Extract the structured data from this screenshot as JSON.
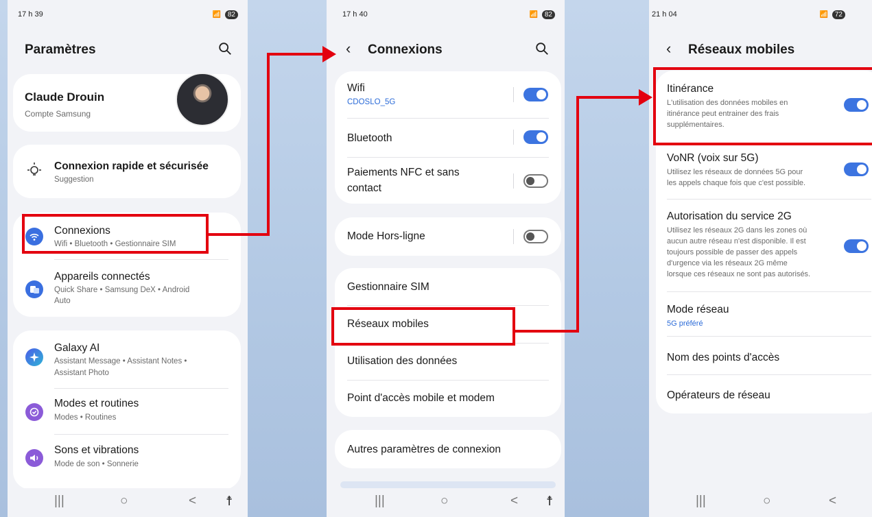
{
  "colors": {
    "accent": "#3c74e0",
    "highlight": "#e3000f",
    "background": "#c4d6ec"
  },
  "phone1": {
    "status": {
      "time": "17 h 39",
      "battery": "82"
    },
    "title": "Paramètres",
    "account": {
      "name": "Claude Drouin",
      "subtitle": "Compte Samsung"
    },
    "suggestion": {
      "title": "Connexion rapide et sécurisée",
      "subtitle": "Suggestion"
    },
    "items": [
      {
        "label": "Connexions",
        "sub": "Wifi • Bluetooth • Gestionnaire SIM",
        "icon": "wifi-icon"
      },
      {
        "label": "Appareils connectés",
        "sub1": "Quick Share • Samsung DeX • Android",
        "sub2": "Auto",
        "icon": "connected-devices-icon"
      },
      {
        "label": "Galaxy AI",
        "sub1": "Assistant Message • Assistant Notes •",
        "sub2": "Assistant Photo",
        "icon": "galaxy-ai-icon"
      },
      {
        "label": "Modes et routines",
        "sub": "Modes • Routines",
        "icon": "modes-icon"
      },
      {
        "label": "Sons et vibrations",
        "sub": "Mode de son • Sonnerie",
        "icon": "sound-icon"
      }
    ]
  },
  "phone2": {
    "status": {
      "time": "17 h 40",
      "battery": "82"
    },
    "title": "Connexions",
    "wifi": {
      "label": "Wifi",
      "sub": "CDOSLO_5G",
      "on": true
    },
    "bluetooth": {
      "label": "Bluetooth",
      "on": true
    },
    "nfc": {
      "label1": "Paiements NFC et sans",
      "label2": "contact",
      "on": false
    },
    "airplane": {
      "label": "Mode Hors-ligne",
      "on": false
    },
    "sim": "Gestionnaire SIM",
    "mobile": "Réseaux mobiles",
    "data": "Utilisation des données",
    "hotspot": "Point d'accès mobile et modem",
    "more": "Autres paramètres de connexion"
  },
  "phone3": {
    "status": {
      "time": "21 h 04",
      "battery": "72"
    },
    "title": "Réseaux mobiles",
    "roaming": {
      "label": "Itinérance",
      "sub": [
        "L'utilisation des données mobiles en",
        "itinérance peut entrainer des frais",
        "supplémentaires."
      ],
      "on": true
    },
    "vonr": {
      "label": "VoNR (voix sur 5G)",
      "sub": [
        "Utilisez les réseaux de données 5G pour",
        "les appels chaque fois que c'est possible."
      ],
      "on": true
    },
    "twog": {
      "label": "Autorisation du service 2G",
      "sub": [
        "Utilisez les réseaux 2G dans les zones où",
        "aucun autre réseau n'est disponible. Il est",
        "toujours possible de passer des appels",
        "d'urgence via les réseaux 2G même",
        "lorsque ces réseaux ne sont pas autorisés."
      ],
      "on": true
    },
    "mode": {
      "label": "Mode réseau",
      "sub": "5G préféré"
    },
    "apn": "Nom des points d'accès",
    "operators": "Opérateurs de réseau"
  },
  "nav": {
    "recents": "|||",
    "home": "○",
    "back": "<",
    "accessibility": "☨"
  }
}
